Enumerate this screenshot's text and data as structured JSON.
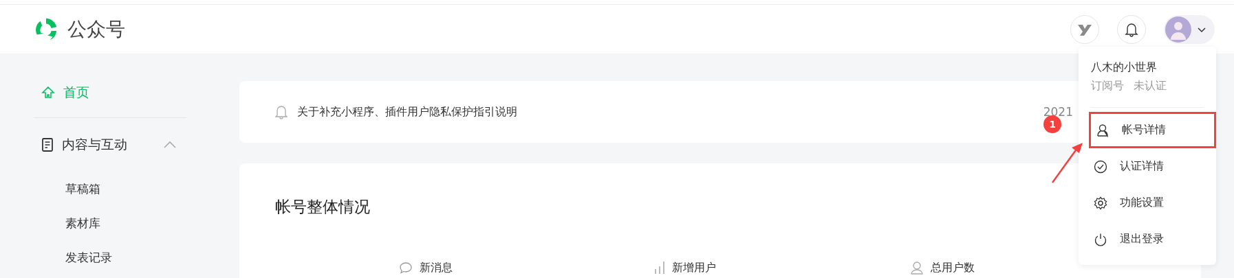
{
  "header": {
    "title": "公众号"
  },
  "sidebar": {
    "items": [
      {
        "label": "首页",
        "kind": "home",
        "selected": true
      },
      {
        "label": "内容与互动",
        "kind": "group",
        "selected": false,
        "expanded": true,
        "children": [
          {
            "label": "草稿箱",
            "selected": false
          },
          {
            "label": "素材库",
            "selected": false
          },
          {
            "label": "发表记录",
            "selected": false
          }
        ]
      }
    ]
  },
  "notice": {
    "text": "关于补充小程序、插件用户隐私保护指引说明",
    "date": "2021"
  },
  "overview": {
    "title": "帐号整体情况",
    "stats": [
      {
        "label": "新消息",
        "kind": "message"
      },
      {
        "label": "新增用户",
        "kind": "growth"
      },
      {
        "label": "总用户数",
        "kind": "users"
      }
    ]
  },
  "account_menu": {
    "name": "八木的小世界",
    "account_type": "订阅号",
    "verification": "未认证",
    "items": [
      {
        "label": "帐号详情",
        "kind": "account",
        "highlighted": true
      },
      {
        "label": "认证详情",
        "kind": "verify",
        "highlighted": false
      },
      {
        "label": "功能设置",
        "kind": "settings",
        "highlighted": false
      },
      {
        "label": "退出登录",
        "kind": "logout",
        "highlighted": false
      }
    ]
  },
  "annotation": {
    "badge": "1"
  }
}
